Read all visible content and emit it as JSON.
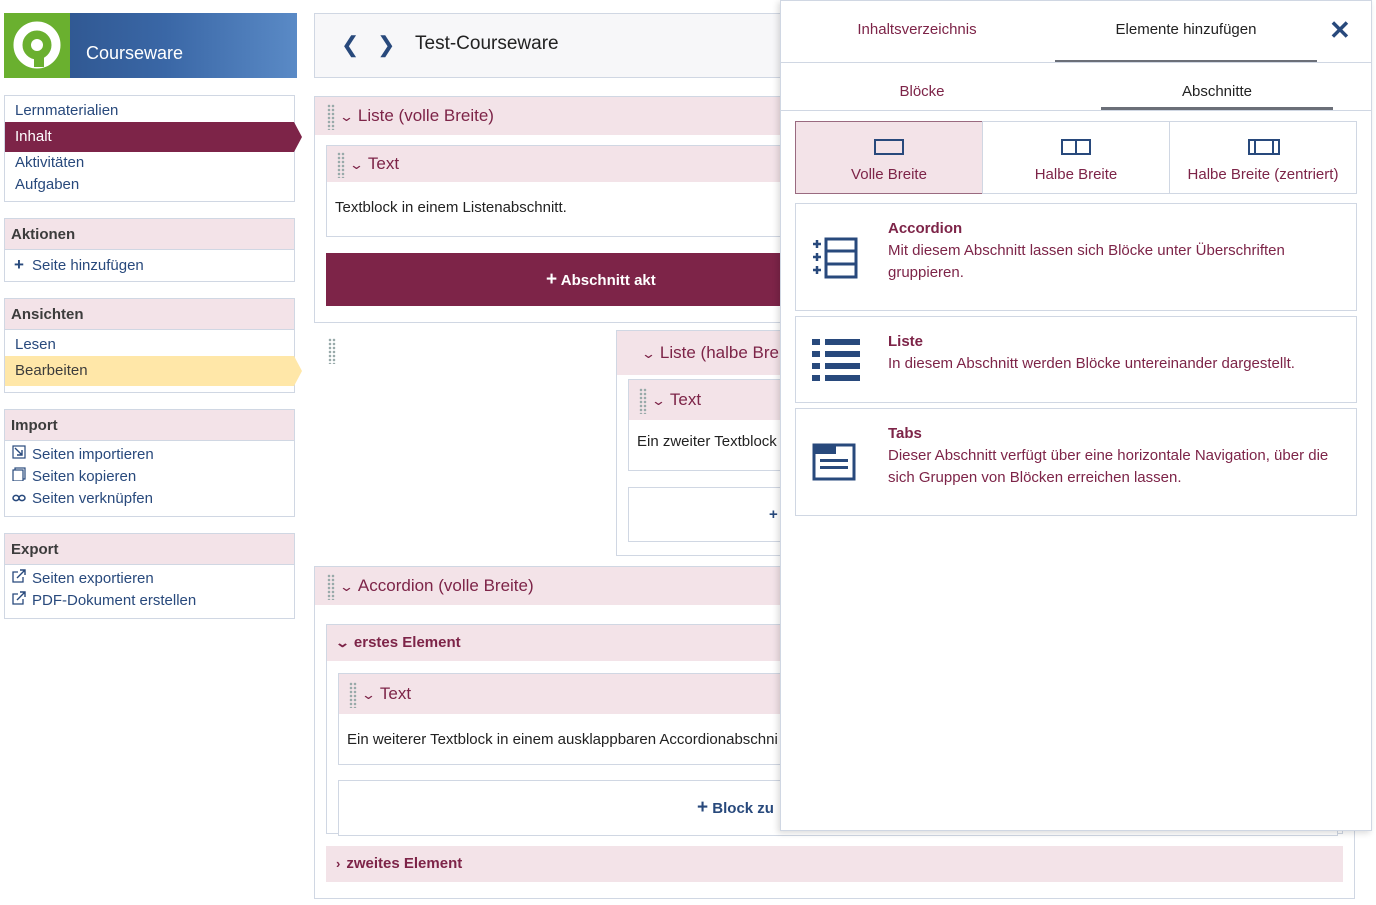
{
  "app": {
    "title": "Courseware"
  },
  "sidebar": {
    "nav": [
      {
        "label": "Lernmaterialien"
      },
      {
        "label": "Inhalt"
      },
      {
        "label": "Aktivitäten"
      },
      {
        "label": "Aufgaben"
      }
    ],
    "actions": {
      "title": "Aktionen",
      "items": [
        {
          "label": "Seite hinzufügen",
          "icon": "plus-icon"
        }
      ]
    },
    "views": {
      "title": "Ansichten",
      "items": [
        {
          "label": "Lesen"
        },
        {
          "label": "Bearbeiten"
        }
      ]
    },
    "import": {
      "title": "Import",
      "items": [
        {
          "label": "Seiten importieren",
          "icon": "import-icon"
        },
        {
          "label": "Seiten kopieren",
          "icon": "copy-icon"
        },
        {
          "label": "Seiten verknüpfen",
          "icon": "link-icon"
        }
      ]
    },
    "export": {
      "title": "Export",
      "items": [
        {
          "label": "Seiten exportieren",
          "icon": "export-icon"
        },
        {
          "label": "PDF-Dokument erstellen",
          "icon": "export-icon"
        }
      ]
    }
  },
  "topbar": {
    "title": "Test-Courseware"
  },
  "content": {
    "section1": {
      "title": "Liste (volle Breite)",
      "block": {
        "title": "Text",
        "text": "Textblock in einem Listenabschnitt."
      },
      "add_label": "Abschnitt akt"
    },
    "section2": {
      "title": "Liste (halbe Brei",
      "block": {
        "title": "Text",
        "text": "Ein zweiter Textblock"
      },
      "add_label": "+"
    },
    "section3": {
      "title": "Accordion (volle Breite)",
      "item1": "erstes Element",
      "block": {
        "title": "Text",
        "text": "Ein weiterer Textblock in einem ausklappbaren Accordionabschni"
      },
      "add_label": "Block zu",
      "item2": "zweites Element"
    }
  },
  "overlay": {
    "tabs": [
      {
        "label": "Inhaltsverzeichnis"
      },
      {
        "label": "Elemente hinzufügen"
      }
    ],
    "subtabs": [
      {
        "label": "Blöcke"
      },
      {
        "label": "Abschnitte"
      }
    ],
    "layouts": [
      {
        "label": "Volle Breite"
      },
      {
        "label": "Halbe Breite"
      },
      {
        "label": "Halbe Breite (zentriert)"
      }
    ],
    "options": [
      {
        "title": "Accordion",
        "description": "Mit diesem Abschnitt lassen sich Blöcke unter Überschriften gruppieren.",
        "icon": "accordion-icon"
      },
      {
        "title": "Liste",
        "description": "In diesem Abschnitt werden Blöcke untereinander dargestellt.",
        "icon": "list-icon"
      },
      {
        "title": "Tabs",
        "description": "Dieser Abschnitt verfügt über eine horizontale Navigation, über die sich Gruppen von Blöcken erreichen lassen.",
        "icon": "tabs-icon"
      }
    ]
  },
  "colors": {
    "brand": "#7d2448",
    "link": "#28497c",
    "header_bg": "#f3e3e8",
    "highlight": "#ffe7a8",
    "logo_green": "#6ab02f"
  }
}
